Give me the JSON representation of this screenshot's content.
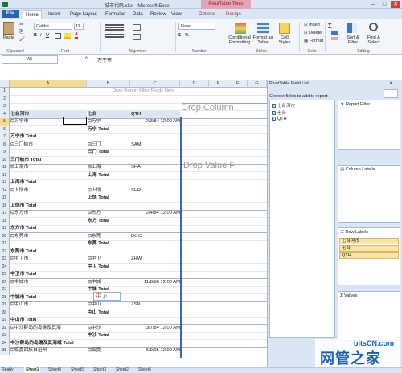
{
  "window": {
    "title": "城市代码.xlsx - Microsoft Excel",
    "context_group": "PivotTable Tools"
  },
  "tabs": [
    "Home",
    "Insert",
    "Page Layout",
    "Formulas",
    "Data",
    "Review",
    "View",
    "Options",
    "Design"
  ],
  "file_tab": "File",
  "ribbon": {
    "paste": "Paste",
    "font_name": "Calibri",
    "font_size": "11",
    "number_format": "Date",
    "conditional": "Conditional Formatting",
    "format_table": "Format as Table",
    "cell_styles": "Cell Styles",
    "insert": "Insert",
    "delete": "Delete",
    "format": "Format",
    "sort_filter": "Sort & Filter",
    "find_select": "Find & Select",
    "groups": [
      "Clipboard",
      "Font",
      "Alignment",
      "Number",
      "Styles",
      "Cells",
      "Editing"
    ]
  },
  "formula_bar": {
    "name_box": "A5",
    "fx": "fx",
    "content": "万宁市"
  },
  "columns": [
    "A",
    "B",
    "C",
    "D",
    "E",
    "F",
    "G"
  ],
  "pivot": {
    "filter_placeholder": "Drop Report Filter Fields Here",
    "column_placeholder": "Drop Column",
    "value_placeholder": "Drop Value F",
    "headers": [
      "七台河市",
      "七台",
      "QTH"
    ]
  },
  "rows": [
    {
      "n": "1",
      "a": "",
      "b": "",
      "c": ""
    },
    {
      "n": "2",
      "a": "",
      "b": "",
      "c": ""
    },
    {
      "n": "3",
      "a": "",
      "b": "",
      "c": ""
    },
    {
      "n": "4",
      "a": "七台河市",
      "b": "七台",
      "c": "QTH"
    },
    {
      "n": "5",
      "a": "⊟万宁市",
      "b": "⊟万宁",
      "c": "2/3/84 12:00 AM"
    },
    {
      "n": "6",
      "a": "",
      "b": "万宁 Total",
      "c": ""
    },
    {
      "n": "7",
      "a": "万宁市 Total",
      "b": "",
      "c": ""
    },
    {
      "n": "8",
      "a": "⊟三门峡市",
      "b": "⊟三门",
      "c": "SAM"
    },
    {
      "n": "9",
      "a": "",
      "b": "三门 Total",
      "c": ""
    },
    {
      "n": "10",
      "a": "三门峡市 Total",
      "b": "",
      "c": ""
    },
    {
      "n": "11",
      "a": "⊟上海市",
      "b": "⊟上海",
      "c": "SHA"
    },
    {
      "n": "12",
      "a": "",
      "b": "上海 Total",
      "c": ""
    },
    {
      "n": "13",
      "a": "上海市 Total",
      "b": "",
      "c": ""
    },
    {
      "n": "14",
      "a": "⊟上饶市",
      "b": "⊟上饶",
      "c": "SHR"
    },
    {
      "n": "15",
      "a": "",
      "b": "上饶 Total",
      "c": ""
    },
    {
      "n": "16",
      "a": "上饶市 Total",
      "b": "",
      "c": ""
    },
    {
      "n": "17",
      "a": "⊟东方市",
      "b": "⊟东方",
      "c": "2/4/84 12:00 AM"
    },
    {
      "n": "18",
      "a": "",
      "b": "东方 Total",
      "c": ""
    },
    {
      "n": "19",
      "a": "东方市 Total",
      "b": "",
      "c": ""
    },
    {
      "n": "20",
      "a": "⊟东莞市",
      "b": "⊟东莞",
      "c": "DGG"
    },
    {
      "n": "21",
      "a": "",
      "b": "东莞 Total",
      "c": ""
    },
    {
      "n": "22",
      "a": "东莞市 Total",
      "b": "",
      "c": ""
    },
    {
      "n": "23",
      "a": "⊟中卫市",
      "b": "⊟中卫",
      "c": "ZHW"
    },
    {
      "n": "24",
      "a": "",
      "b": "中卫 Total",
      "c": ""
    },
    {
      "n": "25",
      "a": "中卫市 Total",
      "b": "",
      "c": ""
    },
    {
      "n": "26",
      "a": "⊟中城市",
      "b": "⊟中城",
      "c": "11/8/66 12:00 AM"
    },
    {
      "n": "27",
      "a": "",
      "b": "中城 Total",
      "c": ""
    },
    {
      "n": "28",
      "a": "中城市 Total",
      "b": "",
      "c": ""
    },
    {
      "n": "29",
      "a": "⊟中山市",
      "b": "⊟中山",
      "c": "ZSN"
    },
    {
      "n": "30",
      "a": "",
      "b": "中山 Total",
      "c": ""
    },
    {
      "n": "31",
      "a": "中山市 Total",
      "b": "",
      "c": ""
    },
    {
      "n": "32",
      "a": "⊟中沙群岛的岛礁及其海",
      "b": "⊟中沙",
      "c": "3/7/84 12:00 AM"
    },
    {
      "n": "33",
      "a": "",
      "b": "中沙 Total",
      "c": ""
    },
    {
      "n": "34",
      "a": "中沙群岛的岛礁及其海域 Total",
      "b": "",
      "c": ""
    },
    {
      "n": "35",
      "a": "⊟临夏回族自治州",
      "b": "⊟临夏",
      "c": "6/9/05 12:00 AM"
    }
  ],
  "ime": "中",
  "field_list": {
    "title": "PivotTable Field List",
    "choose": "Choose fields to add to report:",
    "fields": [
      "七台河市",
      "七台",
      "QTH"
    ],
    "drag_hint": "Drag fields between areas below:",
    "report_filter": "Report Filter",
    "column_labels": "Column Labels",
    "row_labels": "Row Labels",
    "row_items": [
      "七台河市",
      "七台",
      "QTH"
    ],
    "values": "Values"
  },
  "sheets": [
    "Sheet1",
    "Sheet4",
    "Sheet5",
    "Sheet3",
    "Sheet2",
    "Sheet6"
  ],
  "status": "Ready",
  "watermark": {
    "text": "bitsCN.com",
    "brand": "网管之家"
  }
}
